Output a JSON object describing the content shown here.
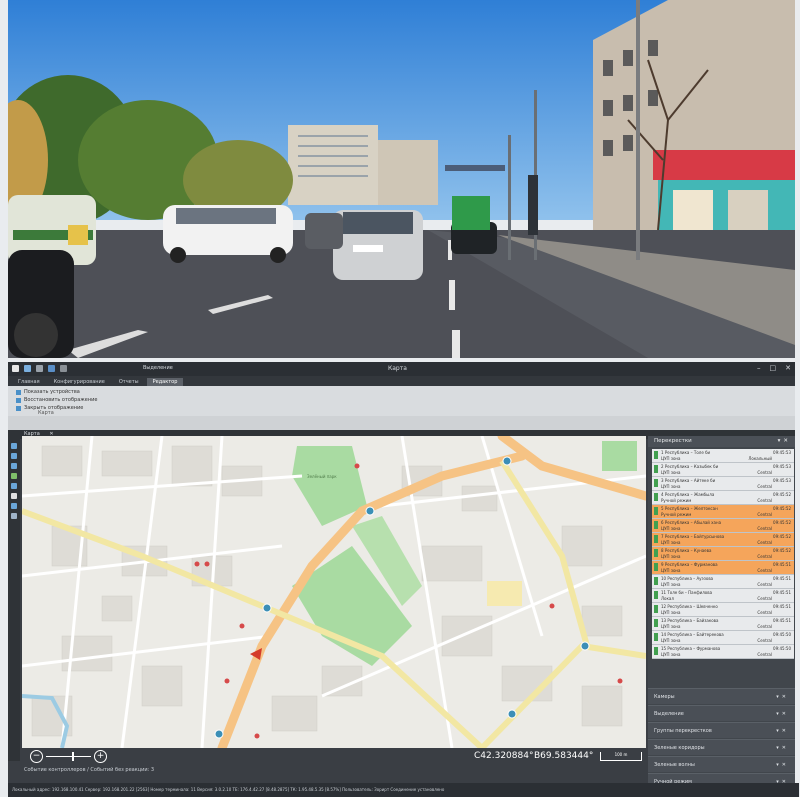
{
  "window": {
    "title": "Карта",
    "context_label": "Выделение"
  },
  "ribbon": {
    "tabs": [
      "Главная",
      "Конфигурирование",
      "Отчеты",
      "Редактор"
    ],
    "items": [
      "Показать устройства",
      "Восстановить отображение",
      "Закрыть отображение"
    ],
    "group_label": "Карта"
  },
  "document_tab": "Карта",
  "map": {
    "park_label": "Зелёный парк",
    "lat": "C42.320884°",
    "lon": "B69.583444°",
    "scale": "100 m"
  },
  "panel": {
    "title": "Перекрестки",
    "rows": [
      {
        "name": "1 Республика – Толе би",
        "sub": "ЦУП зона",
        "status": "Локальный",
        "time": "09:45:53",
        "selected": false
      },
      {
        "name": "2 Республика – Казыбек би",
        "sub": "ЦУП зона",
        "status": "Central",
        "time": "09:45:53",
        "selected": false
      },
      {
        "name": "3 Республика – Айтеке би",
        "sub": "ЦУП зона",
        "status": "Central",
        "time": "09:45:53",
        "selected": false
      },
      {
        "name": "4 Республика – Жамбыла",
        "sub": "Ручной режим",
        "status": "Central",
        "time": "09:45:52",
        "selected": false
      },
      {
        "name": "5 Республика – Желтоксан",
        "sub": "Ручной режим",
        "status": "Central",
        "time": "09:45:52",
        "selected": true
      },
      {
        "name": "6 Республика – Абылай хана",
        "sub": "ЦУП зона",
        "status": "Central",
        "time": "09:45:52",
        "selected": true
      },
      {
        "name": "7 Республика – Байтурсынова",
        "sub": "ЦУП зона",
        "status": "Central",
        "time": "09:45:52",
        "selected": true
      },
      {
        "name": "8 Республика – Кунаева",
        "sub": "ЦУП зона",
        "status": "Central",
        "time": "09:45:52",
        "selected": true
      },
      {
        "name": "9 Республика – Фурманова",
        "sub": "ЦУП зона",
        "status": "Central",
        "time": "09:45:51",
        "selected": true
      },
      {
        "name": "10 Республика – Ауэзова",
        "sub": "ЦУП зона",
        "status": "Central",
        "time": "09:45:51",
        "selected": false
      },
      {
        "name": "11 Толе би – Панфилова",
        "sub": "Локал",
        "status": "Central",
        "time": "09:45:51",
        "selected": false
      },
      {
        "name": "12 Республика – Шевченко",
        "sub": "ЦУП зона",
        "status": "Central",
        "time": "09:45:51",
        "selected": false
      },
      {
        "name": "13 Республика – Байзакова",
        "sub": "ЦУП зона",
        "status": "Central",
        "time": "09:45:51",
        "selected": false
      },
      {
        "name": "14 Республика – Байтерекова",
        "sub": "ЦУП зона",
        "status": "Central",
        "time": "09:45:50",
        "selected": false
      },
      {
        "name": "15 Республика – Фурманова",
        "sub": "ЦУП зона",
        "status": "Central",
        "time": "09:45:50",
        "selected": false
      }
    ],
    "sections": [
      "Камеры",
      "Выделение",
      "Группы перекрестков",
      "Зеленые коридоры",
      "Зеленые волны",
      "Ручной режим"
    ]
  },
  "status": {
    "events": "Событие контроллеров / Событий без реакции: 3",
    "footer": "Локальный адрес: 192.168.100.41  Сервер: 192.168.201.22 [2563]  Номер терминала: 11  Версия: 3.0.2.10  ТЕ: 176.4.42.27 [8.48.2875]  ТК: 1.95.48.5.35 [8.57%]  Пользователь: Зорирт  Соединение установлено"
  }
}
